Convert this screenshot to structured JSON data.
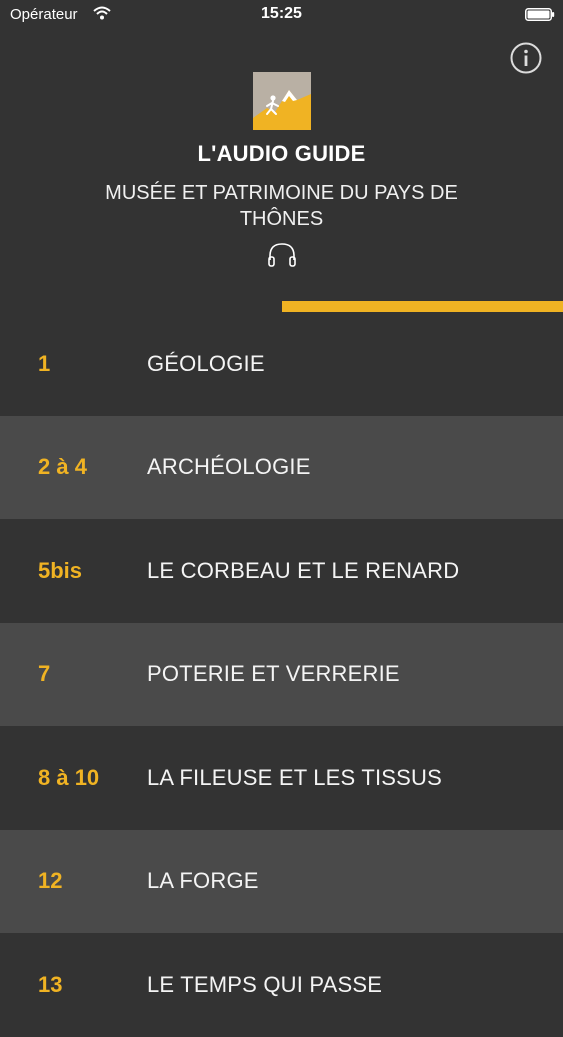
{
  "status_bar": {
    "carrier": "Opérateur",
    "time": "15:25"
  },
  "header": {
    "title": "L'AUDIO GUIDE",
    "subtitle": "MUSÉE ET PATRIMOINE DU PAYS DE THÔNES"
  },
  "colors": {
    "background": "#333333",
    "row_alt": "#4a4a4a",
    "accent": "#f0b323"
  },
  "progress": 0.5,
  "items": [
    {
      "number": "1",
      "label": "GÉOLOGIE"
    },
    {
      "number": "2 à 4",
      "label": "ARCHÉOLOGIE"
    },
    {
      "number": "5bis",
      "label": "LE CORBEAU ET LE RENARD"
    },
    {
      "number": "7",
      "label": "POTERIE ET VERRERIE"
    },
    {
      "number": "8 à 10",
      "label": "LA FILEUSE ET LES TISSUS"
    },
    {
      "number": "12",
      "label": "LA FORGE"
    },
    {
      "number": "13",
      "label": "LE TEMPS QUI PASSE"
    }
  ],
  "icons": {
    "wifi": "wifi-icon",
    "battery": "battery-icon",
    "info": "info-icon",
    "logo": "mountain-hiker-logo",
    "headphones": "headphones-icon"
  }
}
